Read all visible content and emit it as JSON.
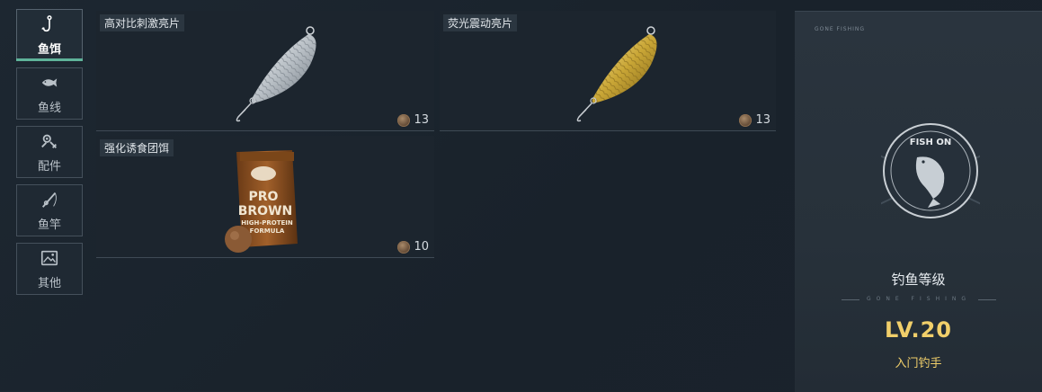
{
  "tabs": [
    {
      "id": "bait",
      "label": "鱼饵",
      "icon": "hook-icon",
      "active": true
    },
    {
      "id": "line",
      "label": "鱼线",
      "icon": "fish-icon",
      "active": false
    },
    {
      "id": "parts",
      "label": "配件",
      "icon": "gear-parts-icon",
      "active": false
    },
    {
      "id": "rod",
      "label": "鱼竿",
      "icon": "fishing-rod-icon",
      "active": false
    },
    {
      "id": "other",
      "label": "其他",
      "icon": "picture-icon",
      "active": false
    }
  ],
  "items": [
    {
      "name": "高对比刺激亮片",
      "count": "13",
      "icon": "silver-spoon-lure"
    },
    {
      "name": "荧光震动亮片",
      "count": "13",
      "icon": "gold-spoon-lure"
    },
    {
      "name": "强化诱食团饵",
      "count": "10",
      "icon": "bait-bag"
    }
  ],
  "bag": {
    "brand": "PRO",
    "brand2": "BROWN",
    "line1": "HIGH-PROTEIN",
    "line2": "FORMULA"
  },
  "level": {
    "title": "钓鱼等级",
    "subtitle": "GONE FISHING",
    "value": "LV.20",
    "rank": "入门钓手",
    "badge_text": "FISH ON",
    "corner_text": "GONE FISHING"
  },
  "colors": {
    "accent": "#5fb39a",
    "gold": "#f1cf6a"
  }
}
